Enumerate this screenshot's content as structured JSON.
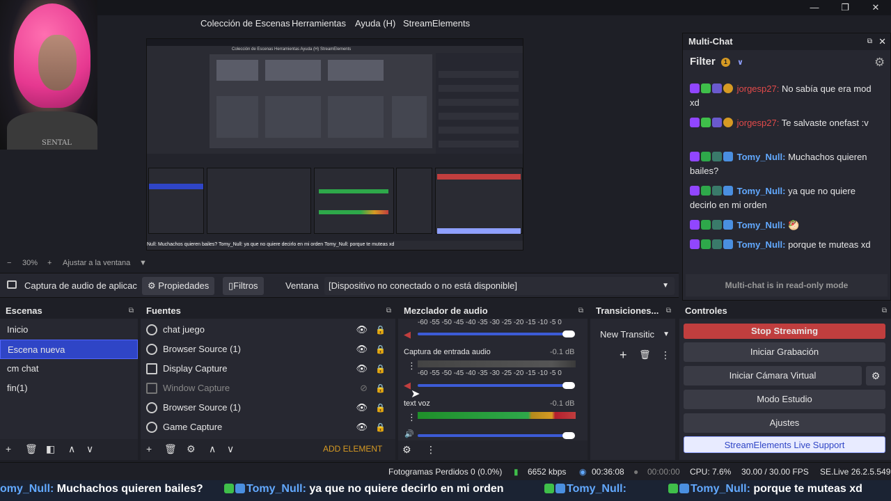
{
  "window": {
    "minimize": "—",
    "restore": "❐",
    "close": "✕"
  },
  "webcam": {
    "shirt_text": "SENTAL"
  },
  "menu": [
    "Colección de Escenas",
    "Herramientas",
    "Ayuda (H)",
    "StreamElements"
  ],
  "preview_mini": {
    "menu": "Colección de Escenas   Herramientas   Ayuda (H)   StreamElements",
    "ticker": "Null: Muchachos quieren bailes?  Tomy_Null: ya que no quiere decirlo en mi orden  Tomy_Null:  porque te muteas xd"
  },
  "zoom": {
    "minus": "−",
    "value": "30%",
    "plus": "+",
    "fit": "Ajustar a la ventana",
    "arrow": "▼"
  },
  "source_bar": {
    "name": "Captura de audio de aplicac",
    "properties": "Propiedades",
    "filters": "Filtros",
    "window_label": "Ventana",
    "window_value": "[Dispositivo no conectado o no está disponible]"
  },
  "scenes": {
    "title": "Escenas",
    "items": [
      "Inicio",
      "Escena nueva",
      "cm chat",
      "fin(1)"
    ],
    "selected": 1
  },
  "sources": {
    "title": "Fuentes",
    "items": [
      {
        "name": "chat juego",
        "visible": true
      },
      {
        "name": "Browser Source (1)",
        "visible": true
      },
      {
        "name": "Display Capture",
        "visible": true
      },
      {
        "name": "Window Capture",
        "visible": false
      },
      {
        "name": "Browser Source (1)",
        "visible": true
      },
      {
        "name": "Game Capture",
        "visible": true
      }
    ],
    "add_element": "ADD ELEMENT"
  },
  "mixer": {
    "title": "Mezclador de audio",
    "scale": "-60  -55  -50  -45  -40  -35  -30  -25  -20  -15  -10  -5   0",
    "channels": [
      {
        "name": "Captura de entrada audio",
        "db": "-0.1 dB"
      },
      {
        "name": "text voz",
        "db": "-0.1 dB"
      }
    ]
  },
  "transitions": {
    "title": "Transiciones...",
    "value": "New Transitic"
  },
  "controls": {
    "title": "Controles",
    "stop": "Stop Streaming",
    "record": "Iniciar Grabación",
    "virtualcam": "Iniciar Cámara Virtual",
    "studio": "Modo Estudio",
    "settings": "Ajustes",
    "support": "StreamElements Live Support"
  },
  "multichat": {
    "title": "Multi-Chat",
    "filter": "Filter",
    "filter_count": "1",
    "readonly": "Multi-chat is in read-only mode",
    "messages": [
      {
        "user": "jorgesp27:",
        "text": " No sabía que era mod xd"
      },
      {
        "user": "jorgesp27:",
        "text": " Te salvaste onefast :v"
      },
      {
        "user": "Tomy_Null:",
        "text": " Muchachos quieren bailes?"
      },
      {
        "user": "Tomy_Null:",
        "text": " ya que no quiere decirlo en mi orden"
      },
      {
        "user": "Tomy_Null:",
        "text": " 🥙"
      },
      {
        "user": "Tomy_Null:",
        "text": " porque te muteas xd"
      }
    ]
  },
  "status": {
    "dropped": "Fotogramas Perdidos 0 (0.0%)",
    "kbps": "6652 kbps",
    "live_time": "00:36:08",
    "rec_time": "00:00:00",
    "cpu": "CPU: 7.6%",
    "fps": "30.00 / 30.00 FPS",
    "version": "SE.Live 26.2.5.549"
  },
  "ticker": [
    {
      "user": "omy_Null:",
      "text": " Muchachos quieren bailes?"
    },
    {
      "user": "Tomy_Null:",
      "text": " ya que no quiere decirlo en mi orden"
    },
    {
      "user": "Tomy_Null:",
      "text": ""
    },
    {
      "user": "Tomy_Null:",
      "text": " porque te muteas xd"
    }
  ],
  "colors": {
    "accent": "#2f45c6",
    "stop": "#c03e3e",
    "bg": "#1e1f26",
    "panel": "#272831",
    "twitch": "#9146ff",
    "user_blue": "#62a9ff",
    "user_red": "#e24a4a"
  }
}
